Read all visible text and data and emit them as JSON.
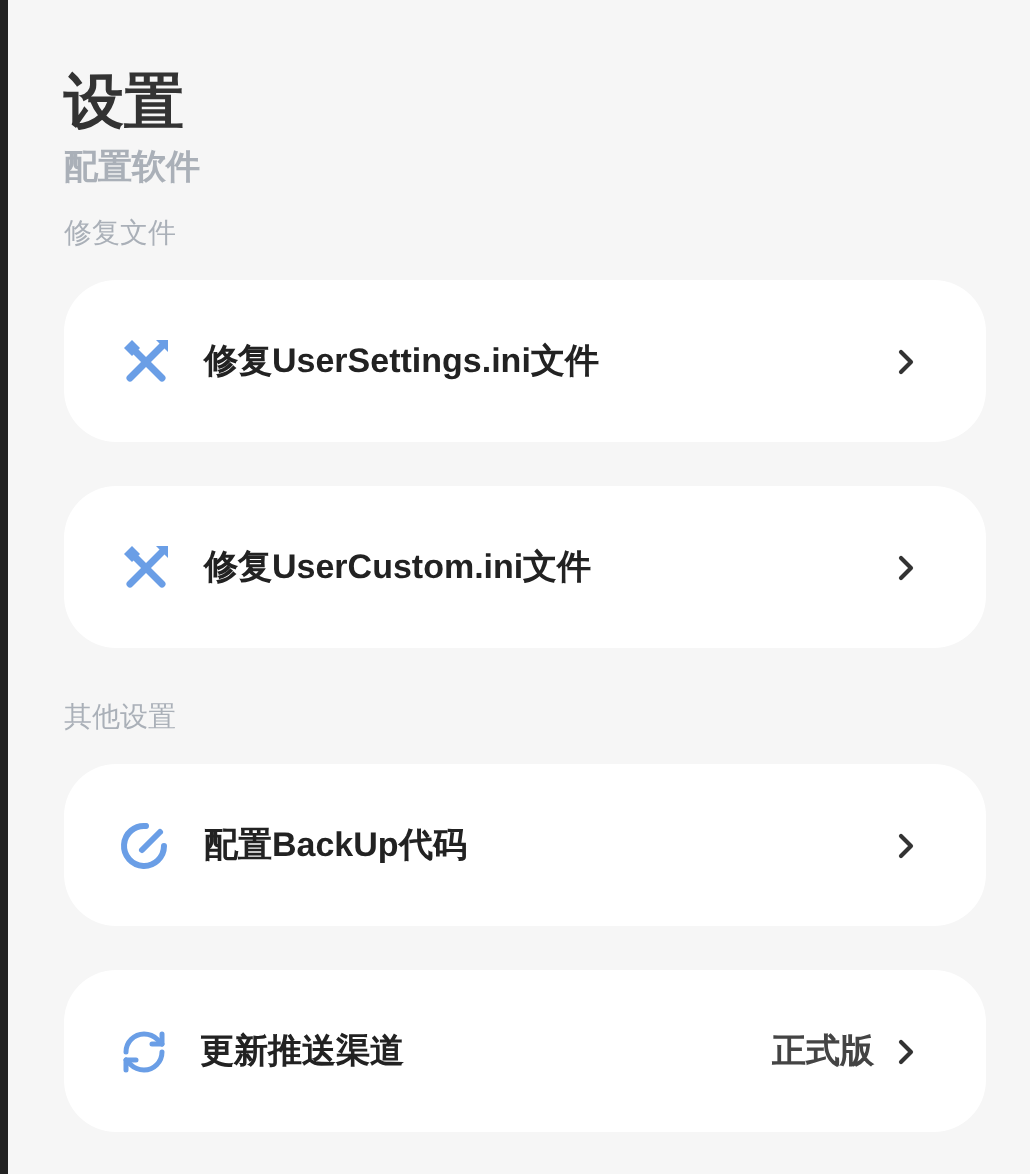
{
  "header": {
    "title": "设置",
    "subtitle": "配置软件"
  },
  "sections": [
    {
      "label": "修复文件",
      "items": [
        {
          "kind": "tools",
          "label": "修复UserSettings.ini文件"
        },
        {
          "kind": "tools",
          "label": "修复UserCustom.ini文件"
        }
      ]
    },
    {
      "label": "其他设置",
      "items": [
        {
          "kind": "edit",
          "label": "配置BackUp代码"
        },
        {
          "kind": "sync",
          "label": "更新推送渠道",
          "value": "正式版"
        }
      ]
    }
  ]
}
